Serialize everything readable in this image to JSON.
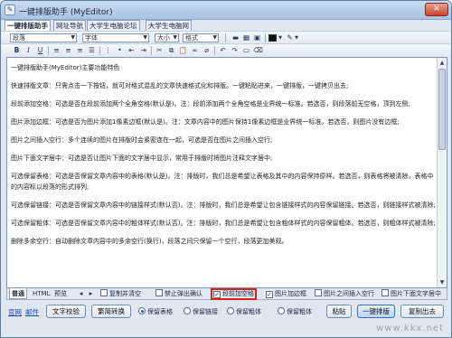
{
  "window": {
    "title": "一键排版助手 (MyEditor)",
    "close_label": "✕"
  },
  "tabs": [
    {
      "label": "一键排版助手",
      "active": true
    },
    {
      "label": "网址导航",
      "active": false
    },
    {
      "label": "大学生电脑论坛",
      "active": false
    },
    {
      "label": "大学生电脑网",
      "active": false
    }
  ],
  "toolbar": {
    "paragraph_combo": "段落",
    "font_combo": "字体",
    "size_combo": "大小",
    "format_combo": "格式",
    "bold_label": "B",
    "italic_label": "I",
    "underline_label": "U",
    "accent_color": "#1d5fb0"
  },
  "editor": {
    "paragraphs": [
      "一键排版助手(MyEditor)主要功能特色",
      "快速排版文章：只需点击一下按钮，就可对格式混乱的文章快速格式化和排版。一键粘贴进来，一键排版，一键拷贝出去;",
      "段前添加空格：可选是否在段前添加两个全角空格(默认是)。注：段前添加两个全角空格是业界统一标准。若选否，则段落前无空格，顶到左侧;",
      "图片添加边框：可选是否为图片添加1像素边框(默认是)。注：文章内容中的图片保持1像素边框是业界统一标准。若选否，则图片没有边框;",
      "图片之间插入空行：多个连续的图片在排版时会紧密连在一起，可选是否在图片之间插入空行;",
      "图片下面文字居中：可选是否让图片下面的文字居中显示，常用于排版时将图片注释文字居中;",
      "可选保留表格：可选是否保留文章内容中的表格(默认是)。注：排版时，我们总是希望让表格及其中的内容保持原样。若选否，则表格将被清除，表格中的内容标以段落的形式排列;",
      "可选保留链接：可选是否保留文章内容中的链接样式(默认否)。注：排版时，我们总是希望让包含链接样式的内容保留链接。若选否，则链接样式被清除;",
      "可选保留粗体：可选是否保留文章内容中的粗体样式(默认否)。注：排版时，我们总是希望让包含粗体样式的内容保留粗体。若选否，则粗体样式被清除;",
      "删除多余空行：自动删除文章内容中的多余空行(换行)，段落之间只保留一个空行，段落更加美观。"
    ]
  },
  "bottom_tabs": [
    {
      "label": "普通",
      "active": true
    },
    {
      "label": "HTML",
      "active": false
    },
    {
      "label": "预览",
      "active": false
    }
  ],
  "options": [
    {
      "label": "复制并清空",
      "checked": false,
      "highlighted": false
    },
    {
      "label": "禁止弹出确认",
      "checked": false,
      "highlighted": false
    },
    {
      "label": "段前加空格",
      "checked": true,
      "highlighted": true
    },
    {
      "label": "图片加边框",
      "checked": true,
      "highlighted": false
    },
    {
      "label": "图片之间插入空行",
      "checked": false,
      "highlighted": false
    },
    {
      "label": "图片下面文字居中",
      "checked": false,
      "highlighted": false
    }
  ],
  "actions": {
    "link_home": "官网",
    "link_mail": "邮件",
    "word_count_button": "文字校验",
    "simplify_button": "繁简转换",
    "radios": [
      {
        "label": "保留表格",
        "on": true
      },
      {
        "label": "保留链接",
        "on": false
      },
      {
        "label": "保留粗体",
        "on": false
      },
      {
        "label": "保留粗体",
        "on": false
      }
    ],
    "paste_button": "粘贴",
    "format_button": "一键排版",
    "copy_button": "复制出去"
  },
  "watermark": "www.kkx.net"
}
